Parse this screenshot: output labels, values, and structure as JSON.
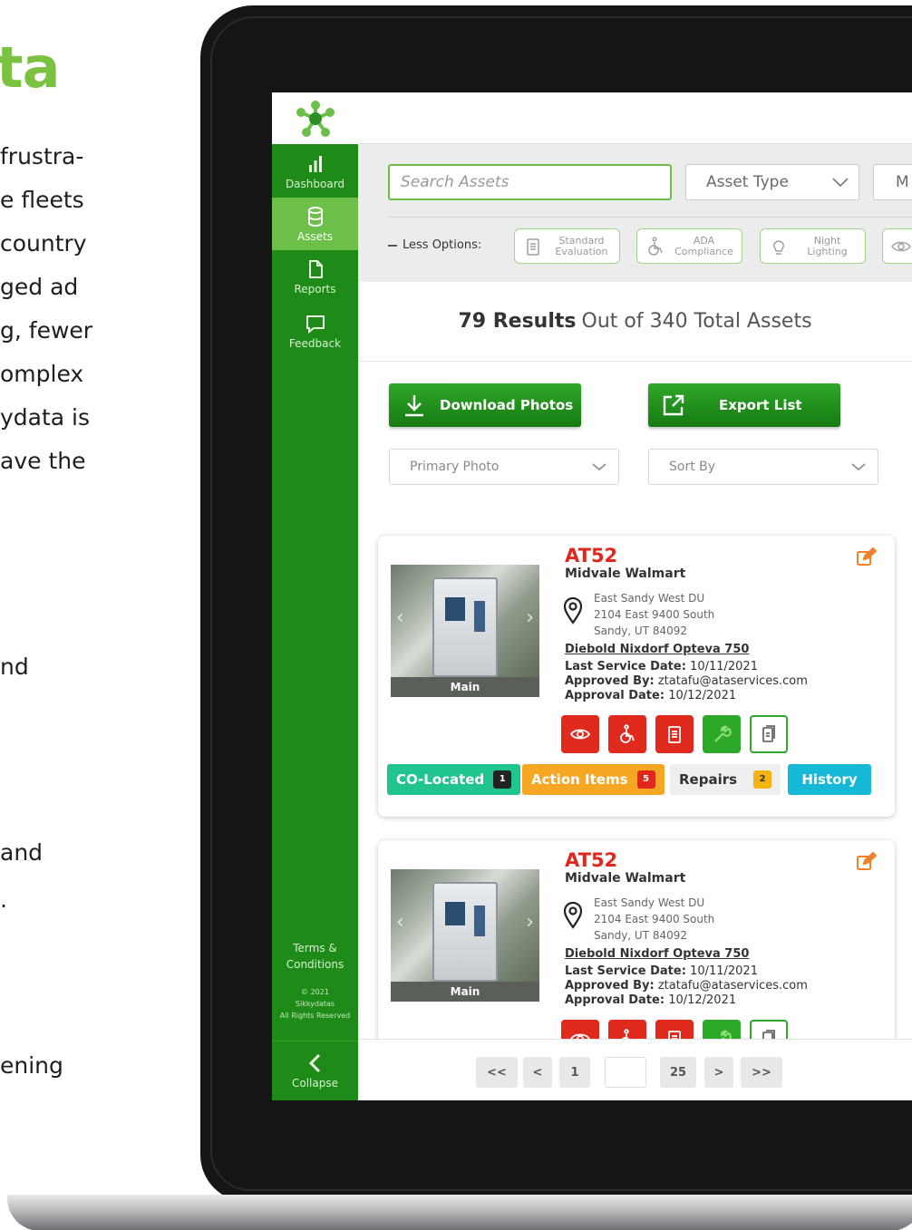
{
  "marketing": {
    "brand_fragment": "ta",
    "lines": [
      "frustra-",
      "e fleets",
      "country",
      "ged ad",
      "g, fewer",
      "omplex",
      "ydata is",
      "ave the",
      "nd",
      "and",
      ".",
      "ening"
    ]
  },
  "sidebar": {
    "items": [
      {
        "label": "Dashboard",
        "icon": "bar-chart-icon"
      },
      {
        "label": "Assets",
        "icon": "database-icon"
      },
      {
        "label": "Reports",
        "icon": "document-icon"
      },
      {
        "label": "Feedback",
        "icon": "chat-bubble-icon"
      }
    ],
    "active": "Assets",
    "terms_line1": "Terms &",
    "terms_line2": "Conditions",
    "copyright_line1": "© 2021",
    "copyright_line2": "Sikkydatas",
    "copyright_line3": "All Rights Reserved",
    "collapse_label": "Collapse"
  },
  "filters": {
    "search_placeholder": "Search Assets",
    "asset_type": "Asset Type",
    "third_select_fragment": "M",
    "less_options_label": "Less Options:",
    "option_pills": [
      {
        "line1": "Standard",
        "line2": "Evaluation",
        "icon": "clipboard-icon"
      },
      {
        "line1": "ADA",
        "line2": "Compliance",
        "icon": "wheelchair-icon"
      },
      {
        "line1": "Night",
        "line2": "Lighting",
        "icon": "lightbulb-icon"
      }
    ]
  },
  "results": {
    "count_text": "79 Results",
    "rest_text": "Out of 340 Total Assets"
  },
  "actions": {
    "download_label": "Download Photos",
    "export_label": "Export List",
    "photo_select": "Primary Photo",
    "sort_select": "Sort By"
  },
  "cards": [
    {
      "id": "AT52",
      "name": "Midvale Walmart",
      "addr1": "East Sandy West DU",
      "addr2": "2104 East 9400 South",
      "addr3": "Sandy, UT 84092",
      "model": "Diebold Nixdorf Opteva 750",
      "service_label": "Last Service Date:",
      "service_value": "10/11/2021",
      "approved_label": "Approved By:",
      "approved_value": "ztatafu@ataservices.com",
      "approval_label": "Approval Date:",
      "approval_value": "10/12/2021",
      "photo_caption": "Main",
      "tags": [
        {
          "label": "CO-Located",
          "count": "1"
        },
        {
          "label": "Action Items",
          "count": "5"
        },
        {
          "label": "Repairs",
          "count": "2"
        },
        {
          "label": "History",
          "count": ""
        }
      ]
    },
    {
      "id": "AT52",
      "name": "Midvale Walmart",
      "addr1": "East Sandy West DU",
      "addr2": "2104 East 9400 South",
      "addr3": "Sandy, UT 84092",
      "model": "Diebold Nixdorf Opteva 750",
      "service_label": "Last Service Date:",
      "service_value": "10/11/2021",
      "approved_label": "Approved By:",
      "approved_value": "ztatafu@ataservices.com",
      "approval_label": "Approval Date:",
      "approval_value": "10/12/2021",
      "photo_caption": "Main"
    }
  ],
  "pager": {
    "first": "<<",
    "prev": "<",
    "page": "1",
    "page_size": "25",
    "next": ">",
    "last": ">>"
  },
  "colors": {
    "brand_green": "#1e8a17",
    "accent_green": "#6cc04a",
    "asset_id_red": "#e1271b",
    "colocated_teal": "#1fc48f",
    "action_items_orange": "#f5a623",
    "history_cyan": "#16b8d8"
  }
}
